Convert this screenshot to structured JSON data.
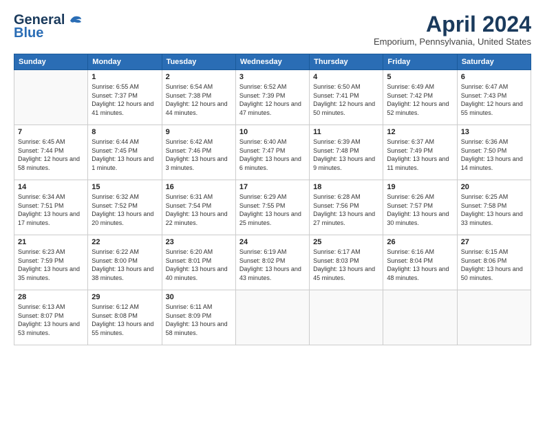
{
  "header": {
    "logo_line1": "General",
    "logo_line2": "Blue",
    "month": "April 2024",
    "location": "Emporium, Pennsylvania, United States"
  },
  "weekdays": [
    "Sunday",
    "Monday",
    "Tuesday",
    "Wednesday",
    "Thursday",
    "Friday",
    "Saturday"
  ],
  "weeks": [
    [
      {
        "day": "",
        "sunrise": "",
        "sunset": "",
        "daylight": ""
      },
      {
        "day": "1",
        "sunrise": "Sunrise: 6:55 AM",
        "sunset": "Sunset: 7:37 PM",
        "daylight": "Daylight: 12 hours and 41 minutes."
      },
      {
        "day": "2",
        "sunrise": "Sunrise: 6:54 AM",
        "sunset": "Sunset: 7:38 PM",
        "daylight": "Daylight: 12 hours and 44 minutes."
      },
      {
        "day": "3",
        "sunrise": "Sunrise: 6:52 AM",
        "sunset": "Sunset: 7:39 PM",
        "daylight": "Daylight: 12 hours and 47 minutes."
      },
      {
        "day": "4",
        "sunrise": "Sunrise: 6:50 AM",
        "sunset": "Sunset: 7:41 PM",
        "daylight": "Daylight: 12 hours and 50 minutes."
      },
      {
        "day": "5",
        "sunrise": "Sunrise: 6:49 AM",
        "sunset": "Sunset: 7:42 PM",
        "daylight": "Daylight: 12 hours and 52 minutes."
      },
      {
        "day": "6",
        "sunrise": "Sunrise: 6:47 AM",
        "sunset": "Sunset: 7:43 PM",
        "daylight": "Daylight: 12 hours and 55 minutes."
      }
    ],
    [
      {
        "day": "7",
        "sunrise": "Sunrise: 6:45 AM",
        "sunset": "Sunset: 7:44 PM",
        "daylight": "Daylight: 12 hours and 58 minutes."
      },
      {
        "day": "8",
        "sunrise": "Sunrise: 6:44 AM",
        "sunset": "Sunset: 7:45 PM",
        "daylight": "Daylight: 13 hours and 1 minute."
      },
      {
        "day": "9",
        "sunrise": "Sunrise: 6:42 AM",
        "sunset": "Sunset: 7:46 PM",
        "daylight": "Daylight: 13 hours and 3 minutes."
      },
      {
        "day": "10",
        "sunrise": "Sunrise: 6:40 AM",
        "sunset": "Sunset: 7:47 PM",
        "daylight": "Daylight: 13 hours and 6 minutes."
      },
      {
        "day": "11",
        "sunrise": "Sunrise: 6:39 AM",
        "sunset": "Sunset: 7:48 PM",
        "daylight": "Daylight: 13 hours and 9 minutes."
      },
      {
        "day": "12",
        "sunrise": "Sunrise: 6:37 AM",
        "sunset": "Sunset: 7:49 PM",
        "daylight": "Daylight: 13 hours and 11 minutes."
      },
      {
        "day": "13",
        "sunrise": "Sunrise: 6:36 AM",
        "sunset": "Sunset: 7:50 PM",
        "daylight": "Daylight: 13 hours and 14 minutes."
      }
    ],
    [
      {
        "day": "14",
        "sunrise": "Sunrise: 6:34 AM",
        "sunset": "Sunset: 7:51 PM",
        "daylight": "Daylight: 13 hours and 17 minutes."
      },
      {
        "day": "15",
        "sunrise": "Sunrise: 6:32 AM",
        "sunset": "Sunset: 7:52 PM",
        "daylight": "Daylight: 13 hours and 20 minutes."
      },
      {
        "day": "16",
        "sunrise": "Sunrise: 6:31 AM",
        "sunset": "Sunset: 7:54 PM",
        "daylight": "Daylight: 13 hours and 22 minutes."
      },
      {
        "day": "17",
        "sunrise": "Sunrise: 6:29 AM",
        "sunset": "Sunset: 7:55 PM",
        "daylight": "Daylight: 13 hours and 25 minutes."
      },
      {
        "day": "18",
        "sunrise": "Sunrise: 6:28 AM",
        "sunset": "Sunset: 7:56 PM",
        "daylight": "Daylight: 13 hours and 27 minutes."
      },
      {
        "day": "19",
        "sunrise": "Sunrise: 6:26 AM",
        "sunset": "Sunset: 7:57 PM",
        "daylight": "Daylight: 13 hours and 30 minutes."
      },
      {
        "day": "20",
        "sunrise": "Sunrise: 6:25 AM",
        "sunset": "Sunset: 7:58 PM",
        "daylight": "Daylight: 13 hours and 33 minutes."
      }
    ],
    [
      {
        "day": "21",
        "sunrise": "Sunrise: 6:23 AM",
        "sunset": "Sunset: 7:59 PM",
        "daylight": "Daylight: 13 hours and 35 minutes."
      },
      {
        "day": "22",
        "sunrise": "Sunrise: 6:22 AM",
        "sunset": "Sunset: 8:00 PM",
        "daylight": "Daylight: 13 hours and 38 minutes."
      },
      {
        "day": "23",
        "sunrise": "Sunrise: 6:20 AM",
        "sunset": "Sunset: 8:01 PM",
        "daylight": "Daylight: 13 hours and 40 minutes."
      },
      {
        "day": "24",
        "sunrise": "Sunrise: 6:19 AM",
        "sunset": "Sunset: 8:02 PM",
        "daylight": "Daylight: 13 hours and 43 minutes."
      },
      {
        "day": "25",
        "sunrise": "Sunrise: 6:17 AM",
        "sunset": "Sunset: 8:03 PM",
        "daylight": "Daylight: 13 hours and 45 minutes."
      },
      {
        "day": "26",
        "sunrise": "Sunrise: 6:16 AM",
        "sunset": "Sunset: 8:04 PM",
        "daylight": "Daylight: 13 hours and 48 minutes."
      },
      {
        "day": "27",
        "sunrise": "Sunrise: 6:15 AM",
        "sunset": "Sunset: 8:06 PM",
        "daylight": "Daylight: 13 hours and 50 minutes."
      }
    ],
    [
      {
        "day": "28",
        "sunrise": "Sunrise: 6:13 AM",
        "sunset": "Sunset: 8:07 PM",
        "daylight": "Daylight: 13 hours and 53 minutes."
      },
      {
        "day": "29",
        "sunrise": "Sunrise: 6:12 AM",
        "sunset": "Sunset: 8:08 PM",
        "daylight": "Daylight: 13 hours and 55 minutes."
      },
      {
        "day": "30",
        "sunrise": "Sunrise: 6:11 AM",
        "sunset": "Sunset: 8:09 PM",
        "daylight": "Daylight: 13 hours and 58 minutes."
      },
      {
        "day": "",
        "sunrise": "",
        "sunset": "",
        "daylight": ""
      },
      {
        "day": "",
        "sunrise": "",
        "sunset": "",
        "daylight": ""
      },
      {
        "day": "",
        "sunrise": "",
        "sunset": "",
        "daylight": ""
      },
      {
        "day": "",
        "sunrise": "",
        "sunset": "",
        "daylight": ""
      }
    ]
  ]
}
